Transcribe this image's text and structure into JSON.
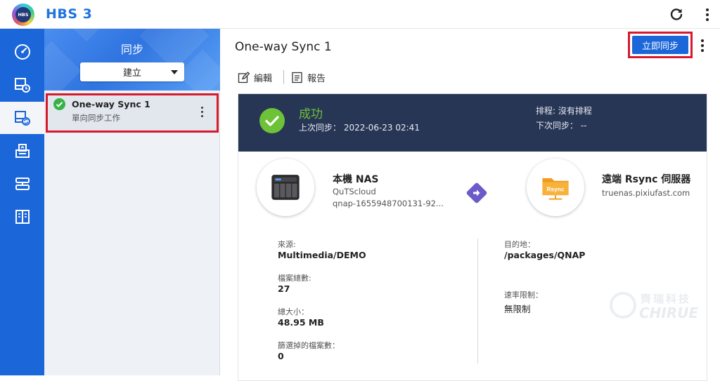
{
  "app": {
    "logo_text": "HBS",
    "title": "HBS 3"
  },
  "rail": {
    "items": [
      {
        "icon": "dashboard-icon"
      },
      {
        "icon": "backup-icon"
      },
      {
        "icon": "sync-icon",
        "active": true
      },
      {
        "icon": "restore-icon"
      },
      {
        "icon": "storage-icon"
      },
      {
        "icon": "services-icon"
      }
    ]
  },
  "task_panel": {
    "title": "同步",
    "create_label": "建立",
    "job": {
      "name": "One-way Sync 1",
      "subtitle": "單向同步工作"
    }
  },
  "main": {
    "title": "One-way Sync 1",
    "sync_now_label": "立即同步",
    "toolbar": {
      "edit_label": "編輯",
      "report_label": "報告"
    },
    "status": {
      "text": "成功",
      "last_sync": "上次同步： 2022-06-23 02:41",
      "schedule": "排程: 沒有排程",
      "next_sync": "下次同步： --"
    },
    "source": {
      "name": "本機 NAS",
      "line1": "QuTScloud",
      "line2": "qnap-1655948700131-92..."
    },
    "destination": {
      "name": "遠端 Rsync 伺服器",
      "line1": "truenas.pixiufast.com",
      "badge": "Rsync"
    },
    "details": {
      "source_label": "來源:",
      "source_value": "Multimedia/DEMO",
      "files_label": "檔案總數:",
      "files_value": "27",
      "size_label": "總大小：",
      "size_value": "48.95 MB",
      "filtered_label": "篩選掉的檔案數：",
      "filtered_value": "0",
      "dest_label": "目的地：",
      "dest_value": "/packages/QNAP",
      "rate_label": "速率限制：",
      "rate_value": "無限制"
    },
    "watermark": {
      "cn": "齊瑞科技",
      "en": "CHIRUE"
    }
  }
}
